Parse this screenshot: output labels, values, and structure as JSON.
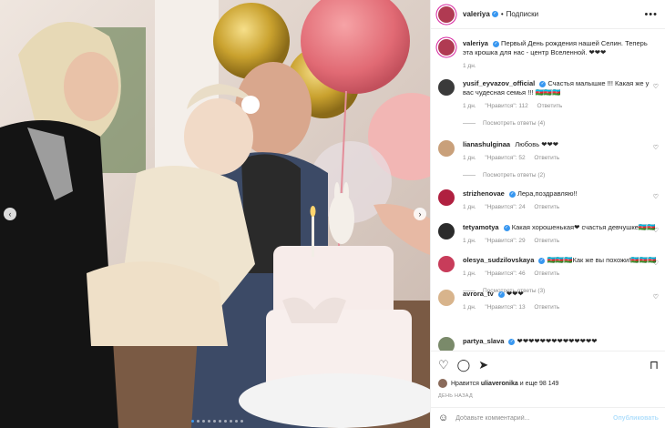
{
  "post": {
    "username": "valeriya",
    "separator": "•",
    "follow_label": "Подписки",
    "caption": "Первый День рождения нашей Селин. Теперь эта крошка для нас - центр Вселенной. ❤❤❤",
    "caption_time": "1 дн."
  },
  "comments": [
    {
      "user": "yusif_eyvazov_official",
      "verified": true,
      "text": "Счастья малышке !!! Какая же у вас чудесная семья !!! 🇦🇿🇦🇿🇦🇿",
      "time": "1 дн.",
      "likes": "\"Нравится\": 112",
      "reply": "Ответить",
      "view_replies": "Посмотреть ответы (4)",
      "avatar": "#3a3a3a"
    },
    {
      "user": "lianashulginaa",
      "verified": false,
      "text": "Любовь ❤❤❤",
      "time": "1 дн.",
      "likes": "\"Нравится\": 52",
      "reply": "Ответить",
      "view_replies": "Посмотреть ответы (2)",
      "avatar": "#c9a07a"
    },
    {
      "user": "strizhenovae",
      "verified": true,
      "text": "Лера,поздравляю!!",
      "time": "1 дн.",
      "likes": "\"Нравится\": 24",
      "reply": "Ответить",
      "view_replies": "",
      "avatar": "#b02040"
    },
    {
      "user": "tetyamotya",
      "verified": true,
      "text": "Какая хорошенькая❤ счастья девчушке🇦🇿🇦🇿",
      "time": "1 дн.",
      "likes": "\"Нравится\": 29",
      "reply": "Ответить",
      "view_replies": "",
      "avatar": "#2b2b2b"
    },
    {
      "user": "olesya_sudzilovskaya",
      "verified": true,
      "text": "🇦🇿🇦🇿🇦🇿Как же вы похожи!🇦🇿🇦🇿🇦🇿",
      "time": "1 дн.",
      "likes": "\"Нравится\": 46",
      "reply": "Ответить",
      "view_replies": "Посмотреть ответы (3)",
      "avatar": "#c83c5a"
    },
    {
      "user": "avrora_tv",
      "verified": true,
      "text": "❤❤❤",
      "time": "1 дн.",
      "likes": "\"Нравится\": 13",
      "reply": "Ответить",
      "view_replies": "",
      "avatar": "#d8b48c"
    },
    {
      "user": "partya_slava",
      "verified": true,
      "text": "❤❤❤❤❤❤❤❤❤❤❤❤❤❤",
      "time": "",
      "likes": "",
      "reply": "",
      "view_replies": "",
      "avatar": "#7a8a6a"
    }
  ],
  "actions": {
    "likes_prefix": "Нравится",
    "liker": "uliaveronika",
    "likes_suffix": "и еще 98 149",
    "date": "ДЕНЬ НАЗАД"
  },
  "add_comment": {
    "placeholder": "Добавьте комментарий...",
    "post_label": "Опубликовать"
  },
  "icons": [
    "heart-icon",
    "comment-icon",
    "share-icon",
    "bookmark-icon",
    "emoji-icon",
    "more-icon",
    "chevron-left-icon",
    "chevron-right-icon"
  ],
  "colors": {
    "accent": "#3897f0",
    "verified": "#3897f0",
    "muted": "#8e8e8e",
    "post_disabled": "#b2dffc"
  },
  "carousel": {
    "total": 10,
    "active": 0
  }
}
